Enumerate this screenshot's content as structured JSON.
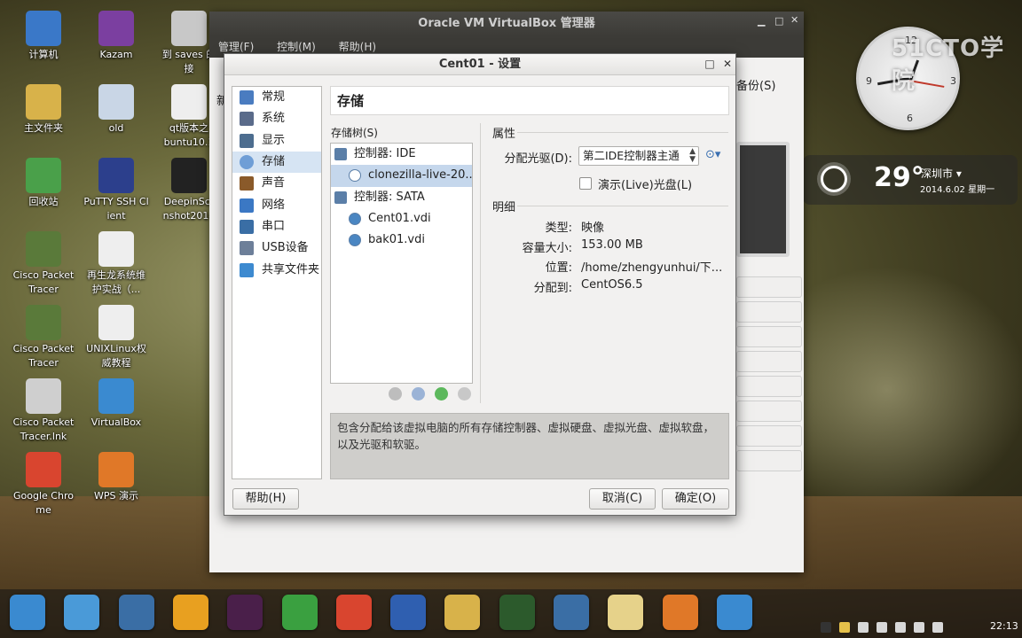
{
  "desktop": {
    "icons": [
      {
        "label": "计算机"
      },
      {
        "label": "Kazam"
      },
      {
        "label": "到 saves 的\n接"
      },
      {
        "label": "主文件夹"
      },
      {
        "label": "old"
      },
      {
        "label": "qt版本之\nbuntu10.1"
      },
      {
        "label": "回收站"
      },
      {
        "label": "PuTTY SSH Cl\nient"
      },
      {
        "label": "DeepinScr\nnshot2014"
      },
      {
        "label": "Cisco Packet\nTracer"
      },
      {
        "label": "再生龙系统维\n护实战（..."
      },
      {
        "label": "Cisco Packet\nTracer"
      },
      {
        "label": "UNIXLinux权\n威教程"
      },
      {
        "label": "Cisco Packet\nTracer.lnk"
      },
      {
        "label": "VirtualBox"
      },
      {
        "label": "Google Chro\nme"
      },
      {
        "label": "WPS 演示"
      }
    ],
    "clock_numbers": {
      "n12": "12",
      "n3": "3",
      "n6": "6",
      "n9": "9"
    },
    "watermark": "51CTO学院",
    "weather": {
      "temp": "29°",
      "city": "深圳市 ▾",
      "date": "2014.6.02 星期一"
    }
  },
  "main_window": {
    "title": "Oracle VM VirtualBox 管理器",
    "menu": [
      "管理(F)",
      "控制(M)",
      "帮助(H)"
    ],
    "backup_label": "备份(S)",
    "partial_label": "新"
  },
  "dialog": {
    "title": "Cent01 - 设置",
    "nav": [
      {
        "label": "常规",
        "color": "#4a7cc0"
      },
      {
        "label": "系统",
        "color": "#5a6b8a"
      },
      {
        "label": "显示",
        "color": "#4d6d8f"
      },
      {
        "label": "存储",
        "color": "#6f9ed6"
      },
      {
        "label": "声音",
        "color": "#8a5a2a"
      },
      {
        "label": "网络",
        "color": "#3b78c4"
      },
      {
        "label": "串口",
        "color": "#3a6ea5"
      },
      {
        "label": "USB设备",
        "color": "#6d7f99"
      },
      {
        "label": "共享文件夹",
        "color": "#3d8ad0"
      }
    ],
    "section_title": "存储",
    "tree_label": "存储树(S)",
    "tree": [
      {
        "label": "控制器: IDE",
        "type": "ctl"
      },
      {
        "label": "clonezilla-live-20...",
        "type": "child",
        "selected": true
      },
      {
        "label": "控制器: SATA",
        "type": "ctl"
      },
      {
        "label": "Cent01.vdi",
        "type": "child"
      },
      {
        "label": "bak01.vdi",
        "type": "child"
      }
    ],
    "attributes": {
      "title": "属性",
      "drive_label": "分配光驱(D):",
      "drive_value": "第二IDE控制器主通",
      "live_cd_label": "演示(Live)光盘(L)"
    },
    "details": {
      "title": "明细",
      "rows": [
        {
          "label": "类型:",
          "value": "映像"
        },
        {
          "label": "容量大小:",
          "value": "153.00  MB"
        },
        {
          "label": "位置:",
          "value": "/home/zhengyunhui/下..."
        },
        {
          "label": "分配到:",
          "value": "CentOS6.5"
        }
      ]
    },
    "description": "包含分配给该虚拟电脑的所有存储控制器、虚拟硬盘、虚拟光盘、虚拟软盘，以及光驱和软驱。",
    "buttons": {
      "help": "帮助(H)",
      "cancel": "取消(C)",
      "ok": "确定(O)"
    }
  },
  "taskbar": {
    "time": "22:13"
  }
}
